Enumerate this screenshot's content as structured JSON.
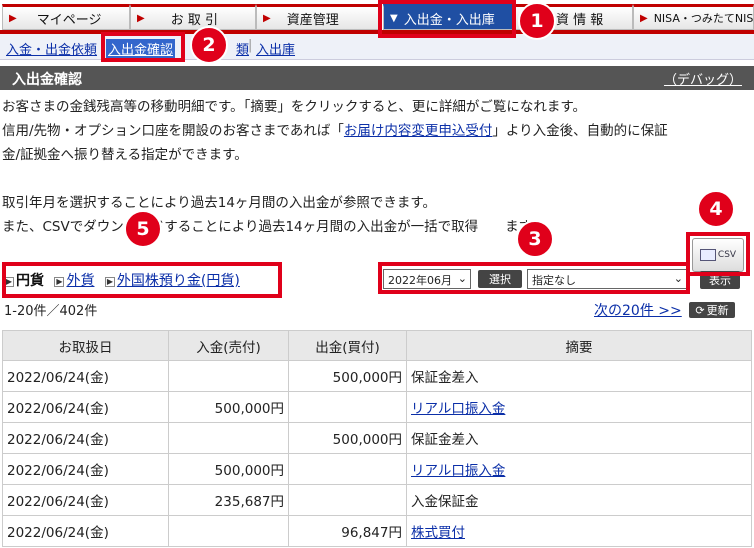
{
  "nav": {
    "tabs": [
      {
        "label": "マイページ"
      },
      {
        "label": "お 取 引"
      },
      {
        "label": "資産管理"
      },
      {
        "label": "入出金・入出庫"
      },
      {
        "label": "資 情 報"
      },
      {
        "label": "NISA・つみたてNISA"
      }
    ]
  },
  "subnav": {
    "items": [
      {
        "label": "入金・出金依頼"
      },
      {
        "label": "入出金確認"
      },
      {
        "label": "類"
      },
      {
        "label": "入出庫"
      }
    ]
  },
  "titlebar": {
    "title": "入出金確認",
    "debug": "（デバッグ）"
  },
  "intro": {
    "line1": "お客さまの金銭残高等の移動明細です。「摘要」をクリックすると、更に詳細がご覧になれます。",
    "line2_pre": "信用/先物・オプション口座を開設のお客さまであれば「",
    "line2_link": "お届け内容変更申込受付",
    "line2_post": "」より入金後、自動的に保証",
    "line3": "金/証拠金へ振り替える指定ができます。",
    "line4": "取引年月を選択することにより過去14ヶ月間の入出金が参照できます。",
    "line5": "また、CSVでダウン　　ドすることにより過去14ヶ月間の入出金が一括で取得　　ます。"
  },
  "currency": {
    "selected": "円貨",
    "foreign": "外貨",
    "foreign_stock": "外国株預り金(円貨)"
  },
  "filters": {
    "month": "2022年06月",
    "select_button": "選択",
    "type": "指定なし",
    "show_button": "表示",
    "csv_label": "CSV"
  },
  "list": {
    "count": "1-20件／402件",
    "next": "次の20件 >>",
    "refresh": "更新"
  },
  "table": {
    "headers": [
      "お取扱日",
      "入金(売付)",
      "出金(買付)",
      "摘要"
    ],
    "rows": [
      {
        "date": "2022/06/24(金)",
        "in": "",
        "out": "500,000円",
        "memo": "保証金差入",
        "link": false
      },
      {
        "date": "2022/06/24(金)",
        "in": "500,000円",
        "out": "",
        "memo": "リアル口振入金",
        "link": true
      },
      {
        "date": "2022/06/24(金)",
        "in": "",
        "out": "500,000円",
        "memo": "保証金差入",
        "link": false
      },
      {
        "date": "2022/06/24(金)",
        "in": "500,000円",
        "out": "",
        "memo": "リアル口振入金",
        "link": true
      },
      {
        "date": "2022/06/24(金)",
        "in": "235,687円",
        "out": "",
        "memo": "入金保証金",
        "link": false
      },
      {
        "date": "2022/06/24(金)",
        "in": "",
        "out": "96,847円",
        "memo": "株式買付",
        "link": true
      }
    ]
  },
  "badges": [
    "1",
    "2",
    "3",
    "4",
    "5"
  ]
}
